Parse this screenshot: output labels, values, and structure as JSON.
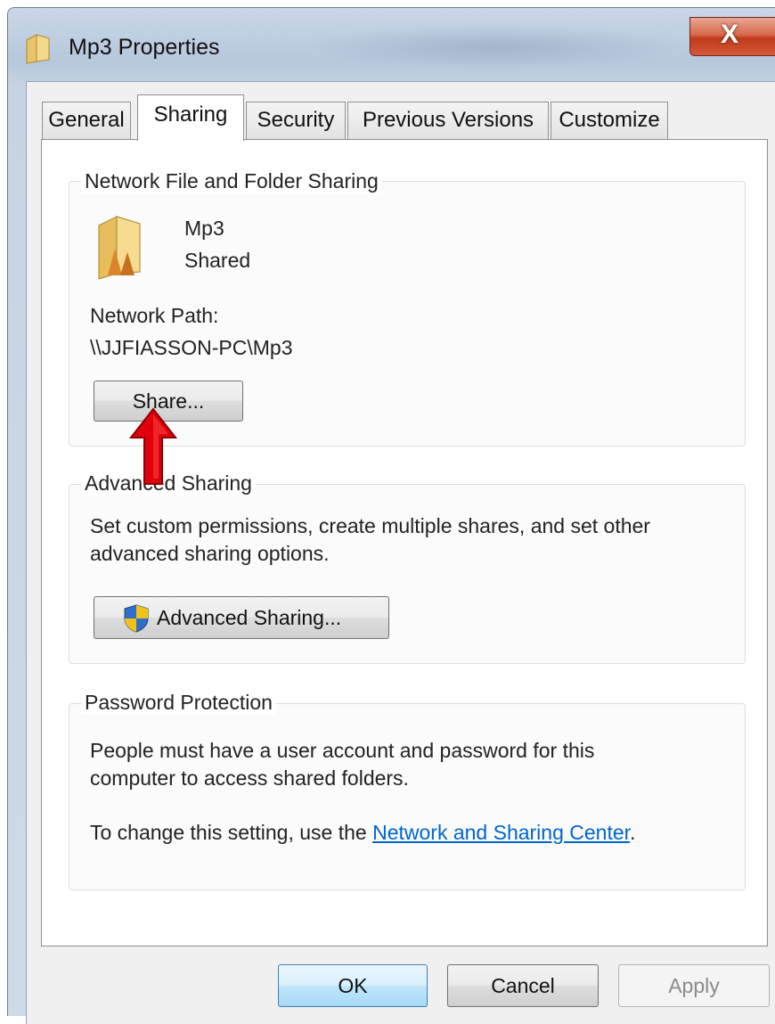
{
  "window": {
    "title": "Mp3 Properties",
    "close_glyph": "X"
  },
  "tabs": [
    {
      "label": "General",
      "active": false
    },
    {
      "label": "Sharing",
      "active": true
    },
    {
      "label": "Security",
      "active": false
    },
    {
      "label": "Previous Versions",
      "active": false
    },
    {
      "label": "Customize",
      "active": false
    }
  ],
  "network_sharing": {
    "legend": "Network File and Folder Sharing",
    "folder_name": "Mp3",
    "folder_status": "Shared",
    "path_label": "Network Path:",
    "path_value": "\\\\JJFIASSON-PC\\Mp3",
    "share_button": "Share..."
  },
  "advanced_sharing": {
    "legend": "Advanced Sharing",
    "description_line1": "Set custom permissions, create multiple shares, and set other",
    "description_line2": "advanced sharing options.",
    "button": "Advanced Sharing..."
  },
  "password_protection": {
    "legend": "Password Protection",
    "line1": "People must have a user account and password for this",
    "line2": "computer to access shared folders.",
    "change_prefix": "To change this setting, use the ",
    "link": "Network and Sharing Center",
    "change_suffix": "."
  },
  "footer": {
    "ok": "OK",
    "cancel": "Cancel",
    "apply": "Apply"
  },
  "icons": {
    "title": "folder-icon",
    "folder": "shared-folder-icon",
    "shield": "uac-shield-icon",
    "close": "close-icon",
    "annotation": "red-arrow-icon"
  },
  "colors": {
    "link": "#0066cc",
    "close_button": "#c9462a",
    "arrow": "#e0000b"
  }
}
